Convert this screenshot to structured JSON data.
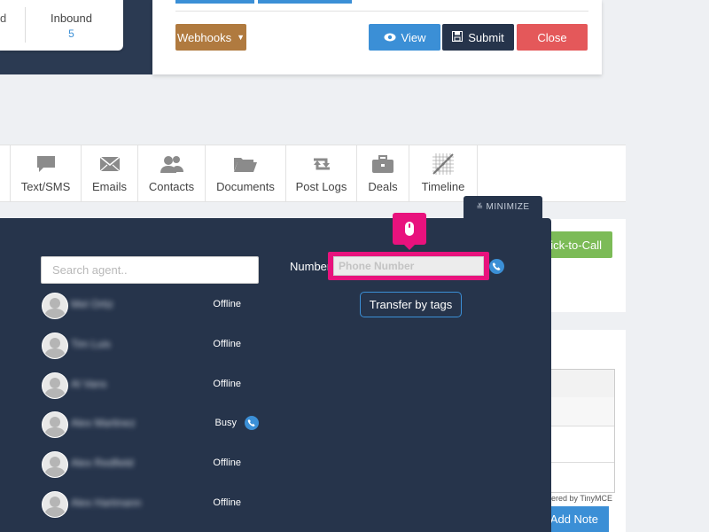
{
  "stats": {
    "prev_label": "d",
    "inbound_label": "Inbound",
    "inbound_value": "5"
  },
  "toolbar": {
    "webhooks_label": "Webhooks",
    "view_label": "View",
    "submit_label": "Submit",
    "close_label": "Close"
  },
  "tabs": [
    {
      "label": "Text/SMS",
      "icon": "chat-icon"
    },
    {
      "label": "Emails",
      "icon": "envelope-icon"
    },
    {
      "label": "Contacts",
      "icon": "contacts-icon"
    },
    {
      "label": "Documents",
      "icon": "folder-icon"
    },
    {
      "label": "Post Logs",
      "icon": "retweet-icon"
    },
    {
      "label": "Deals",
      "icon": "briefcase-icon"
    },
    {
      "label": "Timeline",
      "icon": "timeline-icon"
    }
  ],
  "minimize_label": "MINIMIZE",
  "background": {
    "click_to_call_label": "ick-to-Call",
    "powered_text": "ered by TinyMCE",
    "add_note_label": "Add Note"
  },
  "transfer": {
    "search_placeholder": "Search agent..",
    "agents": [
      {
        "name": "Mel Ortiz",
        "status": "Offline"
      },
      {
        "name": "Tim Luis",
        "status": "Offline"
      },
      {
        "name": "Al Vans",
        "status": "Offline"
      },
      {
        "name": "Alex Martinez",
        "status": "Busy"
      },
      {
        "name": "Alex Redfield",
        "status": "Offline"
      },
      {
        "name": "Alex Hartmann",
        "status": "Offline"
      }
    ],
    "number_label": "Number",
    "phone_placeholder": "Phone Number",
    "transfer_by_tags_label": "Transfer by tags"
  },
  "colors": {
    "panel_dark": "#26344b",
    "accent_blue": "#3b8fd6",
    "highlight_pink": "#e8127d",
    "danger": "#e4585a",
    "success": "#7cbb57"
  }
}
